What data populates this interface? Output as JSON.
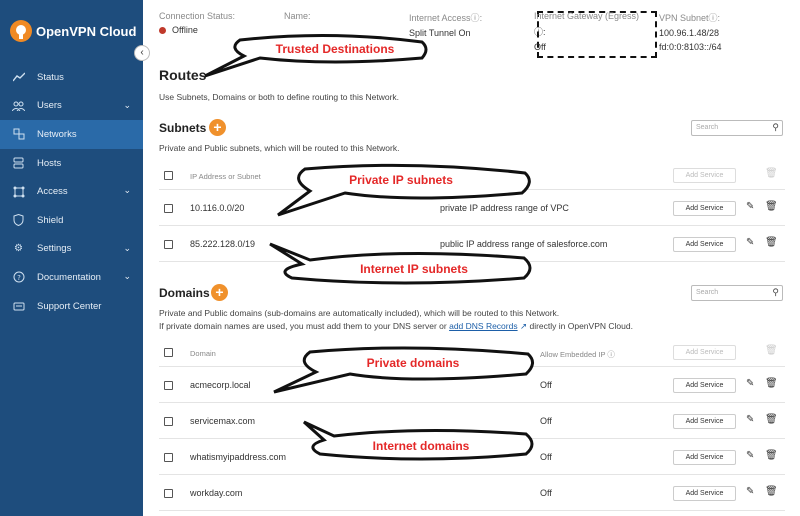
{
  "app": {
    "name": "OpenVPN Cloud"
  },
  "sidebar": {
    "items": [
      {
        "label": "Status",
        "icon": "chart-line-icon",
        "chevron": false,
        "active": false
      },
      {
        "label": "Users",
        "icon": "users-icon",
        "chevron": true,
        "active": false
      },
      {
        "label": "Networks",
        "icon": "network-icon",
        "chevron": false,
        "active": true
      },
      {
        "label": "Hosts",
        "icon": "server-icon",
        "chevron": false,
        "active": false
      },
      {
        "label": "Access",
        "icon": "access-nodes-icon",
        "chevron": true,
        "active": false
      },
      {
        "label": "Shield",
        "icon": "shield-icon",
        "chevron": false,
        "active": false
      },
      {
        "label": "Settings",
        "icon": "gear-icon",
        "chevron": true,
        "active": false
      },
      {
        "label": "Documentation",
        "icon": "question-circle-icon",
        "chevron": true,
        "active": false
      },
      {
        "label": "Support Center",
        "icon": "support-icon",
        "chevron": false,
        "active": false
      }
    ]
  },
  "status_bar": {
    "connection_label": "Connection Status:",
    "connection_value": "Offline",
    "name_label": "Name:",
    "internet_access_label": "Internet Access",
    "internet_access_value": "Split Tunnel On",
    "gateway_label": "Internet Gateway (Egress)",
    "gateway_value": "Off",
    "vpn_subnet_label": "VPN Subnet",
    "vpn_subnet_v4": "100.96.1.48/28",
    "vpn_subnet_v6": "fd:0:0:8103::/64",
    "colon": ":"
  },
  "routes": {
    "title": "Routes",
    "description": "Use Subnets, Domains or both to define routing to this Network."
  },
  "subnets": {
    "title": "Subnets",
    "description": "Private and Public subnets, which will be routed to this Network.",
    "search_placeholder": "Search",
    "column_header": "IP Address or Subnet",
    "add_service_label": "Add Service",
    "rows": [
      {
        "address": "10.116.0.0/20",
        "description": "private IP address range of VPC",
        "action": "Add Service"
      },
      {
        "address": "85.222.128.0/19",
        "description": "public IP address range of salesforce.com",
        "action": "Add Service"
      }
    ]
  },
  "domains": {
    "title": "Domains",
    "description_line1": "Private and Public domains (sub-domains are automatically included), which will be routed to this Network.",
    "description_line2_prefix": "If private domain names are used, you must add them to your DNS server or",
    "description_link": "add DNS Records",
    "description_line2_suffix": "directly in OpenVPN Cloud.",
    "search_placeholder": "Search",
    "column_domain": "Domain",
    "column_embedded": "Allow Embedded IP",
    "add_service_label": "Add Service",
    "rows": [
      {
        "domain": "acmecorp.local",
        "embedded_ip": "Off",
        "action": "Add Service"
      },
      {
        "domain": "servicemax.com",
        "embedded_ip": "Off",
        "action": "Add Service"
      },
      {
        "domain": "whatismyipaddress.com",
        "embedded_ip": "Off",
        "action": "Add Service"
      },
      {
        "domain": "workday.com",
        "embedded_ip": "Off",
        "action": "Add Service"
      }
    ]
  },
  "annotations": {
    "trusted": "Trusted Destinations",
    "private_subnets": "Private IP subnets",
    "internet_subnets": "Internet IP subnets",
    "private_domains": "Private domains",
    "internet_domains": "Internet domains",
    "color": "#e42828"
  }
}
